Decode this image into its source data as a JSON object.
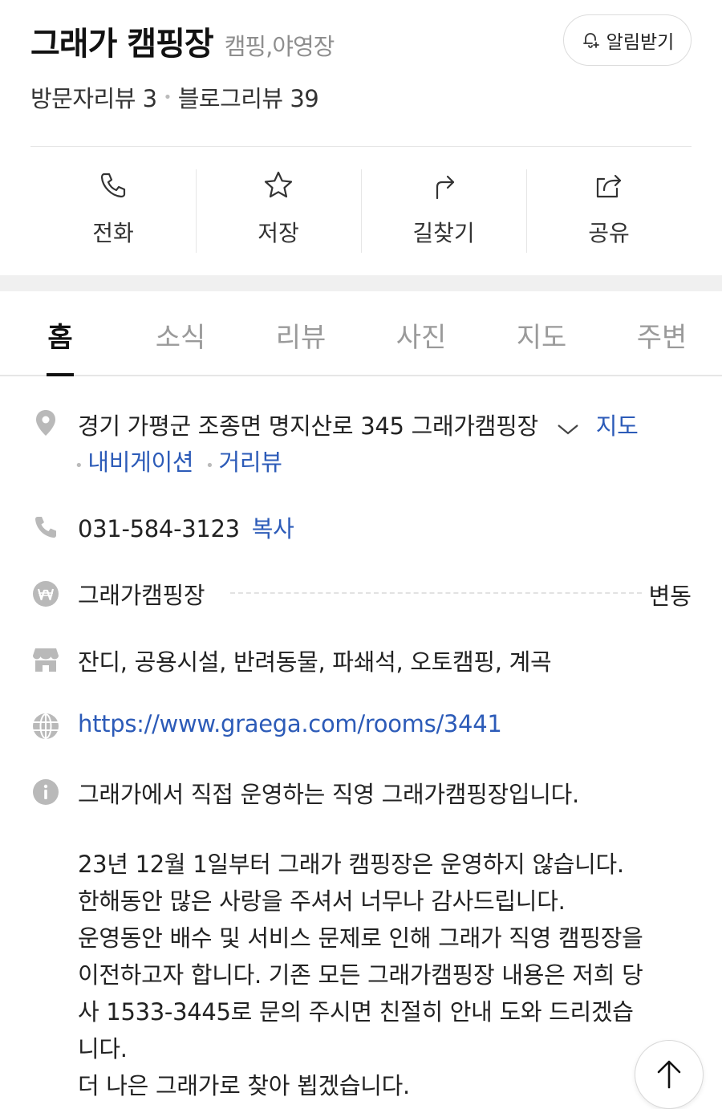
{
  "header": {
    "name": "그래가 캠핑장",
    "category": "캠핑,야영장",
    "alarm_label": "알림받기"
  },
  "reviews": {
    "visitor": "방문자리뷰 3",
    "blog": "블로그리뷰 39"
  },
  "actions": [
    {
      "label": "전화",
      "icon": "phone-icon"
    },
    {
      "label": "저장",
      "icon": "star-icon"
    },
    {
      "label": "길찾기",
      "icon": "directions-icon"
    },
    {
      "label": "공유",
      "icon": "share-icon"
    }
  ],
  "tabs": [
    "홈",
    "소식",
    "리뷰",
    "사진",
    "지도",
    "주변"
  ],
  "info": {
    "address": "경기 가평군 조종면 명지산로 345 그래가캠핑장",
    "map_link": "지도",
    "navigation_link": "내비게이션",
    "streetview_link": "거리뷰",
    "phone": "031-584-3123",
    "copy_label": "복사",
    "price_name": "그래가캠핑장",
    "price_value": "변동",
    "amenities": "잔디, 공용시설, 반려동물, 파쇄석, 오토캠핑, 계곡",
    "website": "https://www.graega.com/rooms/3441",
    "intro": "그래가에서 직접 운영하는 직영 그래가캠핑장입니다."
  },
  "description": [
    "23년 12월 1일부터 그래가 캠핑장은 운영하지 않습니다.",
    "한해동안 많은 사랑을 주셔서 너무나 감사드립니다.",
    "운영동안 배수 및 서비스 문제로 인해 그래가 직영 캠핑장을",
    "이전하고자 합니다. 기존 모든 그래가캠핑장 내용은 저희 당",
    "사 1533-3445로 문의 주시면 친절히 안내 도와 드리겠습",
    "니다.",
    "더 나은 그래가로 찾아 뵙겠습니다."
  ],
  "colors": {
    "link": "#2c5bb8",
    "muted": "#9a9a9a",
    "icon_gray": "#b9b9b9"
  }
}
